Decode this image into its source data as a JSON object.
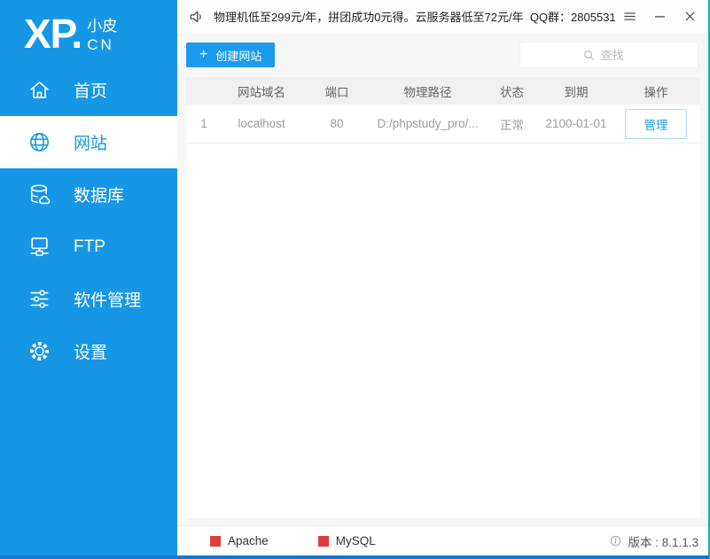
{
  "topbar": {
    "announcement": "物理机低至299元/年，拼团成功0元得。云服务器低至72元/年  QQ群：2805531"
  },
  "sidebar": {
    "logo": {
      "main": "XP.",
      "sub_top": "小皮",
      "sub_bottom": "CN"
    },
    "items": [
      {
        "label": "首页",
        "icon": "home-icon",
        "active": false
      },
      {
        "label": "网站",
        "icon": "globe-icon",
        "active": true
      },
      {
        "label": "数据库",
        "icon": "database-icon",
        "active": false
      },
      {
        "label": "FTP",
        "icon": "ftp-icon",
        "active": false
      },
      {
        "label": "软件管理",
        "icon": "sliders-icon",
        "active": false
      },
      {
        "label": "设置",
        "icon": "gear-icon",
        "active": false
      }
    ]
  },
  "toolbar": {
    "create_site_label": "创建网站",
    "create_site_plus": "+",
    "search_placeholder": "查找"
  },
  "table": {
    "headers": [
      "网站域名",
      "端口",
      "物理路径",
      "状态",
      "到期",
      "操作"
    ],
    "rows": [
      {
        "index": "1",
        "domain": "localhost",
        "port": "80",
        "path": "D:/phpstudy_pro/...",
        "status": "正常",
        "expires": "2100-01-01",
        "action": "管理"
      }
    ]
  },
  "statusbar": {
    "services": [
      {
        "name": "Apache"
      },
      {
        "name": "MySQL"
      }
    ],
    "version_label": "版本 : 8.1.1.3"
  },
  "colors": {
    "sidebar_blue": "#1697e6",
    "button_blue": "#1b9aee",
    "service_red": "#e13b3b",
    "right_border_teal": "#17aebc",
    "bottom_border_blue": "#1477d2",
    "header_gray": "#f0f0f0"
  }
}
